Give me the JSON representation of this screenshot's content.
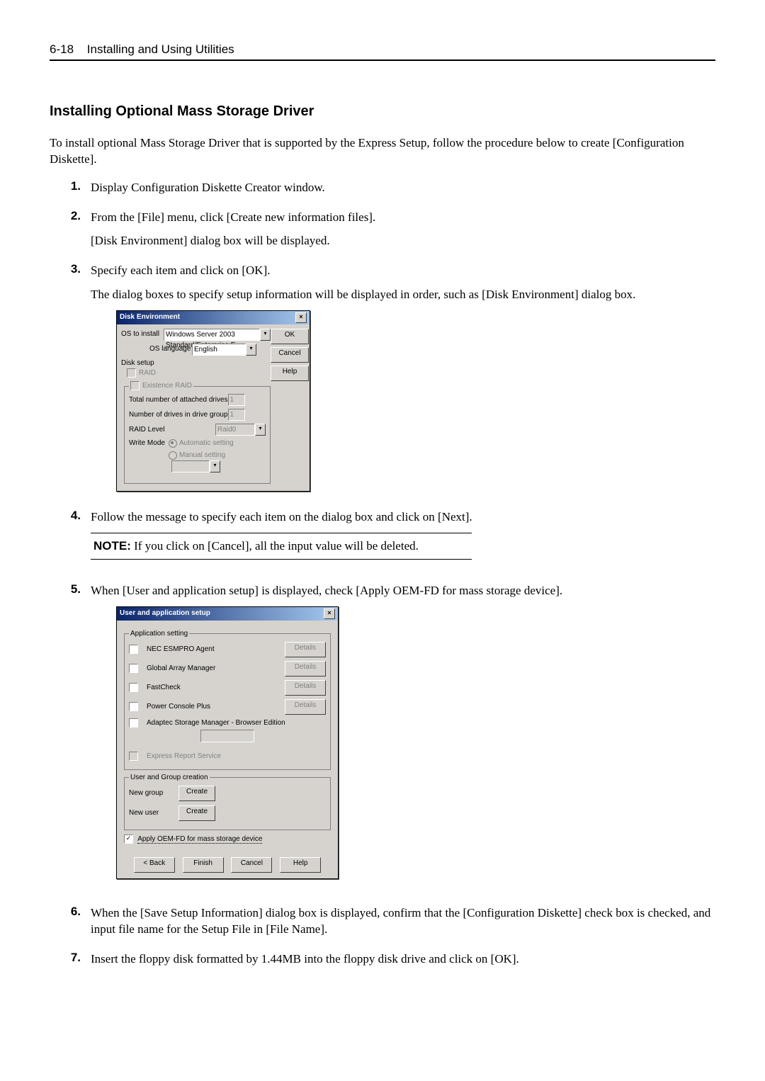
{
  "header": {
    "page": "6-18",
    "title": "Installing and Using Utilities"
  },
  "section_title": "Installing Optional Mass Storage Driver",
  "intro": "To install optional Mass Storage Driver that is supported by the Express Setup, follow the procedure below to create [Configuration Diskette].",
  "steps": {
    "s1": {
      "num": "1.",
      "text": "Display Configuration Diskette Creator window."
    },
    "s2": {
      "num": "2.",
      "text": "From the [File] menu, click [Create new information files].",
      "text2": "[Disk Environment] dialog box will be displayed."
    },
    "s3": {
      "num": "3.",
      "text": "Specify each item and click on [OK].",
      "text2": "The dialog boxes to specify setup information will be displayed in order, such as [Disk Environment] dialog box."
    },
    "s4": {
      "num": "4.",
      "text": "Follow the message to specify each item on the dialog box and click on [Next]."
    },
    "s5": {
      "num": "5.",
      "text": "When [User and application setup] is displayed, check [Apply OEM-FD for mass storage device]."
    },
    "s6": {
      "num": "6.",
      "text": "When the [Save Setup Information] dialog box is displayed, confirm that the [Configuration Diskette] check box is checked, and input file name for the Setup File in [File Name]."
    },
    "s7": {
      "num": "7.",
      "text": "Insert the floppy disk formatted by 1.44MB into the floppy disk drive and click on [OK]."
    }
  },
  "note": {
    "label": "NOTE:",
    "text": " If you click on [Cancel], all the input value will be deleted."
  },
  "dlg1": {
    "title": "Disk Environment",
    "os_to_install_label": "OS to install",
    "os_to_install_value": "Windows Server 2003 Standard/Enterprise E",
    "os_language_label": "OS language",
    "os_language_value": "English",
    "disk_setup_label": "Disk setup",
    "raid_label": "RAID",
    "existence_raid_label": "Existence RAID",
    "total_drives_label": "Total number of attached drives",
    "total_drives_value": "1",
    "num_drives_group_label": "Number of drives in drive group",
    "num_drives_group_value": "1",
    "raid_level_label": "RAID Level",
    "raid_level_value": "Raid0",
    "write_mode_label": "Write Mode",
    "write_mode_auto": "Automatic setting",
    "write_mode_manual": "Manual setting",
    "btn_ok": "OK",
    "btn_cancel": "Cancel",
    "btn_help": "Help"
  },
  "dlg2": {
    "title": "User and application setup",
    "app_setting_legend": "Application setting",
    "nec_esmpro": "NEC ESMPRO Agent",
    "global_array": "Global Array Manager",
    "fastcheck": "FastCheck",
    "power_console": "Power Console Plus",
    "adaptec": "Adaptec Storage Manager - Browser Edition",
    "express_report": "Express Report Service",
    "details": "Details",
    "user_group_legend": "User and Group creation",
    "new_group": "New group",
    "new_user": "New user",
    "create": "Create",
    "apply_oem": "Apply OEM-FD for mass storage device",
    "btn_back": "< Back",
    "btn_finish": "Finish",
    "btn_cancel": "Cancel",
    "btn_help": "Help"
  }
}
